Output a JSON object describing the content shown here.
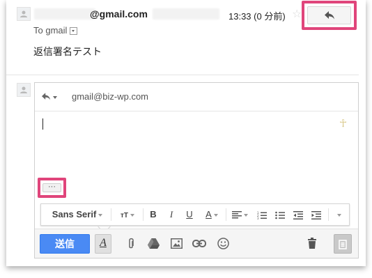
{
  "message": {
    "sender_domain": "@gmail.com",
    "time": "13:33 (0 分前)",
    "star_icon": "star-icon",
    "reply_icon": "reply-icon",
    "to_label": "To gmail",
    "body": "返信署名テスト"
  },
  "compose": {
    "reply_type_icon": "reply-icon",
    "recipient": "gmail@biz-wp.com",
    "show_trimmed_label": "···",
    "send_label": "送信",
    "format_toggle_label": "A"
  },
  "format_bar": {
    "font_label": "Sans Serif",
    "bold": "B",
    "italic": "I",
    "underline": "U",
    "text_color": "A"
  },
  "colors": {
    "highlight": "#e0457b",
    "send_button": "#4a8af4"
  }
}
